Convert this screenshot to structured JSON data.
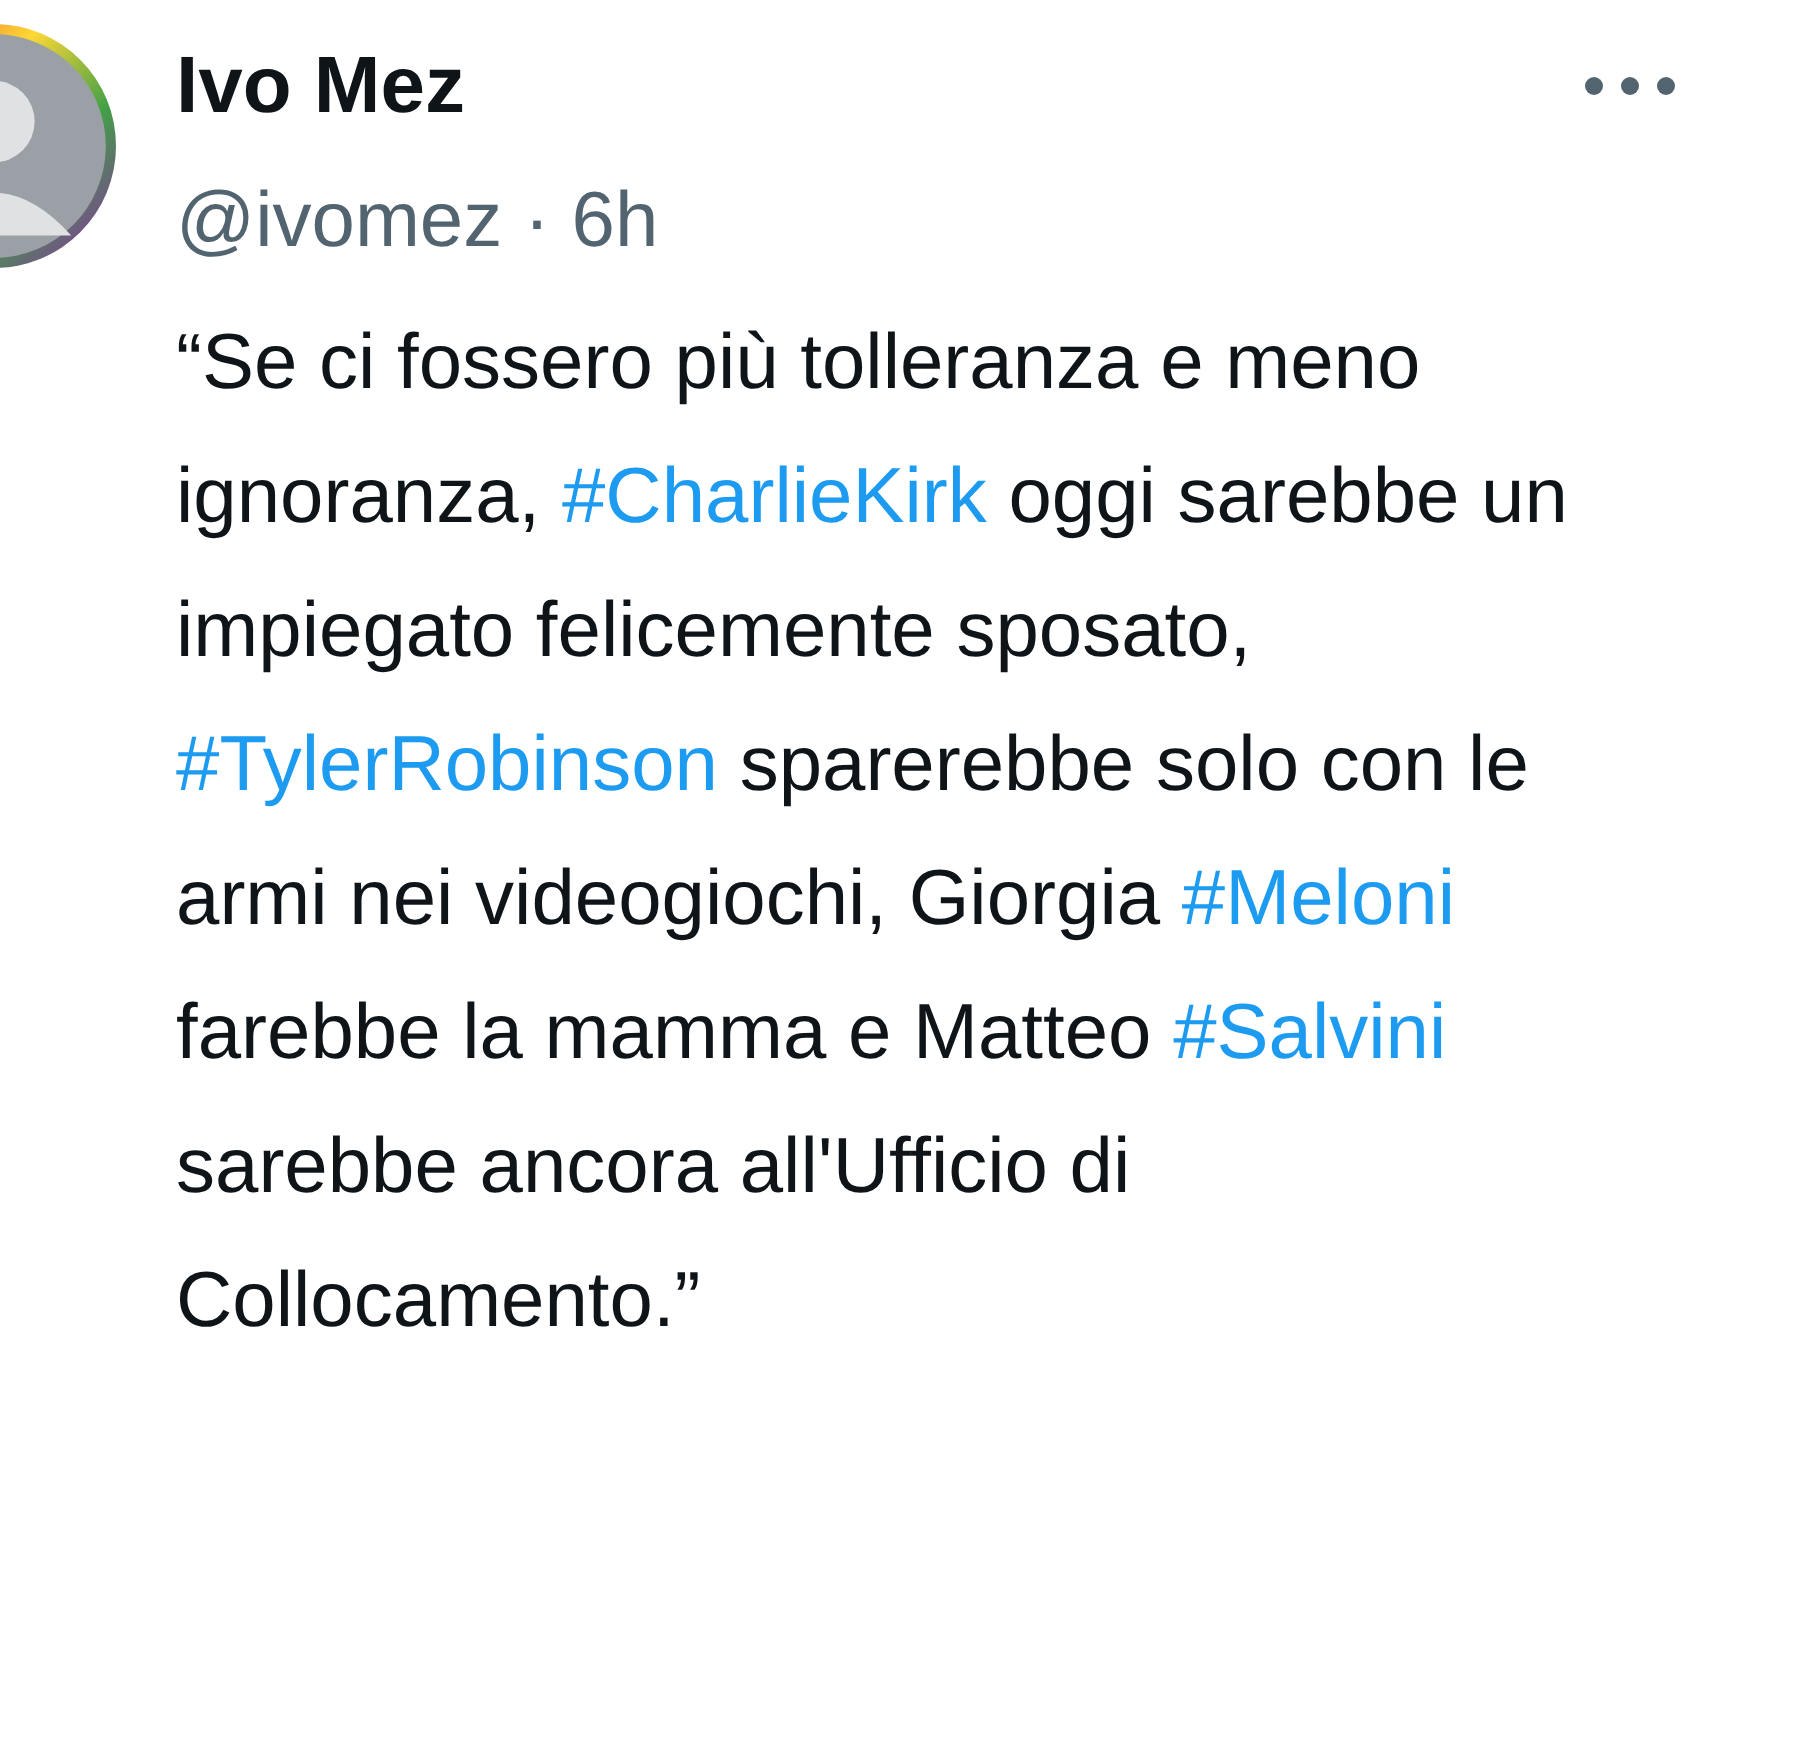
{
  "author": {
    "name": "Ivo Mez",
    "meta": "@ivomez · 6h"
  },
  "text": [
    {
      "kind": "text",
      "text": "“Se ci fossero più tolleranza e meno ignoranza, "
    },
    {
      "kind": "hashtag",
      "text": "#CharlieKirk"
    },
    {
      "kind": "text",
      "text": " oggi sarebbe un impiegato felicemente sposato, "
    },
    {
      "kind": "hashtag",
      "text": "#TylerRobinson"
    },
    {
      "kind": "text",
      "text": " sparerebbe solo con le armi nei videogiochi, Giorgia "
    },
    {
      "kind": "hashtag",
      "text": "#Meloni"
    },
    {
      "kind": "text",
      "text": " farebbe la mamma e Matteo "
    },
    {
      "kind": "hashtag",
      "text": "#Salvini"
    },
    {
      "kind": "text",
      "text": " sarebbe ancora all'Ufficio di Collocamento.”"
    }
  ]
}
